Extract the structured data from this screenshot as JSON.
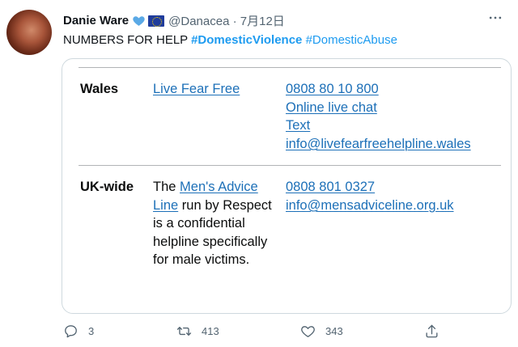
{
  "author": {
    "display_name": "Danie Ware",
    "handle": "@Danacea",
    "separator": "·",
    "date": "7月12日"
  },
  "tweet": {
    "text_plain": "NUMBERS FOR HELP",
    "hashtag_1": "#DomesticViolence",
    "hashtag_2": "#DomesticAbuse"
  },
  "card": {
    "rows": [
      {
        "region": "Wales",
        "service": "Live Fear Free",
        "contacts": [
          "0808 80 10 800",
          "Online live chat",
          "Text",
          "info@livefearfreehelpline.wales"
        ]
      },
      {
        "region": "UK-wide",
        "desc_prefix": "The ",
        "desc_link": "Men's Advice Line",
        "desc_rest": " run by Respect is a confidential helpline specifically for male victims.",
        "contacts": [
          "0808 801 0327",
          "info@mensadviceline.org.uk"
        ]
      }
    ]
  },
  "actions": {
    "reply_count": "3",
    "retweet_count": "413",
    "like_count": "343"
  },
  "icons": {
    "reply": "comment-icon",
    "retweet": "retweet-icon",
    "like": "heart-outline-icon",
    "share": "share-icon",
    "more": "more-icon"
  },
  "colors": {
    "link_blue": "#1d70b8",
    "hashtag_blue": "#1d9bf0",
    "heart_blue": "#5aa9e6"
  }
}
